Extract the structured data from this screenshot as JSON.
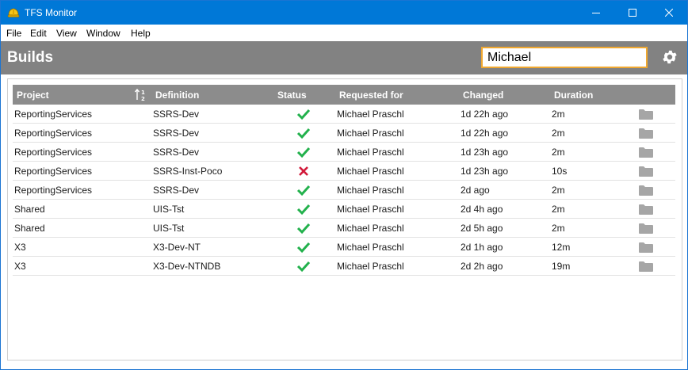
{
  "window": {
    "title": "TFS Monitor",
    "controls": {
      "minimize": "minimize",
      "maximize": "maximize",
      "close": "close"
    }
  },
  "menu": [
    "File",
    "Edit",
    "View",
    "Window",
    "Help"
  ],
  "header": {
    "title": "Builds",
    "search_value": "Michael"
  },
  "grid": {
    "columns": [
      "Project",
      "Definition",
      "Status",
      "Requested for",
      "Changed",
      "Duration"
    ],
    "rows": [
      {
        "project": "ReportingServices",
        "definition": "SSRS-Dev",
        "status": "success",
        "requested_for": "Michael Praschl",
        "changed": "1d 22h ago",
        "duration": "2m"
      },
      {
        "project": "ReportingServices",
        "definition": "SSRS-Dev",
        "status": "success",
        "requested_for": "Michael Praschl",
        "changed": "1d 22h ago",
        "duration": "2m"
      },
      {
        "project": "ReportingServices",
        "definition": "SSRS-Dev",
        "status": "success",
        "requested_for": "Michael Praschl",
        "changed": "1d 23h ago",
        "duration": "2m"
      },
      {
        "project": "ReportingServices",
        "definition": "SSRS-Inst-Poco",
        "status": "failed",
        "requested_for": "Michael Praschl",
        "changed": "1d 23h ago",
        "duration": "10s"
      },
      {
        "project": "ReportingServices",
        "definition": "SSRS-Dev",
        "status": "success",
        "requested_for": "Michael Praschl",
        "changed": "2d ago",
        "duration": "2m"
      },
      {
        "project": "Shared",
        "definition": "UIS-Tst",
        "status": "success",
        "requested_for": "Michael Praschl",
        "changed": "2d 4h ago",
        "duration": "2m"
      },
      {
        "project": "Shared",
        "definition": "UIS-Tst",
        "status": "success",
        "requested_for": "Michael Praschl",
        "changed": "2d 5h ago",
        "duration": "2m"
      },
      {
        "project": "X3",
        "definition": "X3-Dev-NT",
        "status": "success",
        "requested_for": "Michael Praschl",
        "changed": "2d 1h ago",
        "duration": "12m"
      },
      {
        "project": "X3",
        "definition": "X3-Dev-NTNDB",
        "status": "success",
        "requested_for": "Michael Praschl",
        "changed": "2d 2h ago",
        "duration": "19m"
      }
    ]
  },
  "colors": {
    "titlebar": "#0078d7",
    "header": "#828282",
    "success": "#22b14c",
    "failed": "#d21a3a",
    "search_border": "#f0a830"
  },
  "icons": {
    "app": "hardhat-icon",
    "settings": "gear-icon",
    "sort": "sort-ascending-icon",
    "row_action": "folder-icon"
  }
}
